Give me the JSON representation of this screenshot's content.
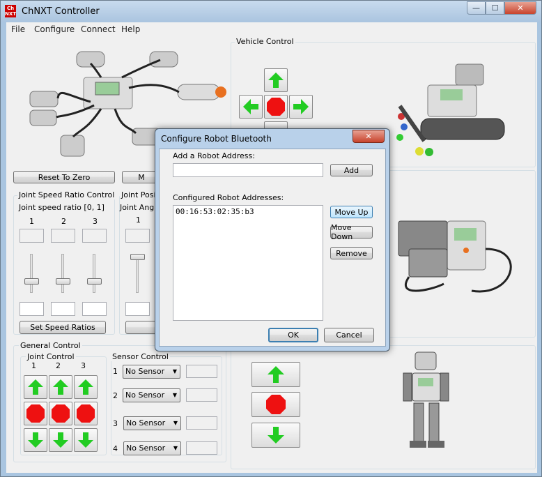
{
  "window": {
    "title": "ChNXT Controller",
    "logo_text": "Ch NXT",
    "minimize": "—",
    "maximize": "☐",
    "close": "✕"
  },
  "menu": [
    "File",
    "Configure",
    "Connect",
    "Help"
  ],
  "left_panel": {
    "reset_button": "Reset To Zero",
    "move_button_partial": "M",
    "joint_speed": {
      "group_title": "Joint Speed Ratio Control",
      "subtitle": "Joint speed ratio [0, 1]",
      "columns": [
        "1",
        "2",
        "3"
      ],
      "button": "Set Speed Ratios"
    },
    "joint_position": {
      "group_title": "Joint Posit",
      "subtitle": "Joint Angle",
      "column": "1"
    }
  },
  "vehicle_control": {
    "title": "Vehicle Control"
  },
  "general_control": {
    "title": "General Control",
    "joint_control": {
      "title": "Joint Control",
      "columns": [
        "1",
        "2",
        "3"
      ]
    },
    "sensor_control": {
      "title": "Sensor Control",
      "rows": [
        {
          "num": "1",
          "value": "No Sensor"
        },
        {
          "num": "2",
          "value": "No Sensor"
        },
        {
          "num": "3",
          "value": "No Sensor"
        },
        {
          "num": "4",
          "value": "No Sensor"
        }
      ]
    }
  },
  "dialog": {
    "title": "Configure Robot Bluetooth",
    "close": "✕",
    "add_label": "Add a Robot Address:",
    "add_value": "",
    "add_button": "Add",
    "configured_label": "Configured Robot Addresses:",
    "addresses": [
      "00:16:53:02:35:b3"
    ],
    "move_up": "Move Up",
    "move_down": "Move Down",
    "remove": "Remove",
    "ok": "OK",
    "cancel": "Cancel"
  },
  "colors": {
    "arrow_green": "#22cc22",
    "stop_red": "#ee1111",
    "titlebar": "#b4cce5"
  }
}
